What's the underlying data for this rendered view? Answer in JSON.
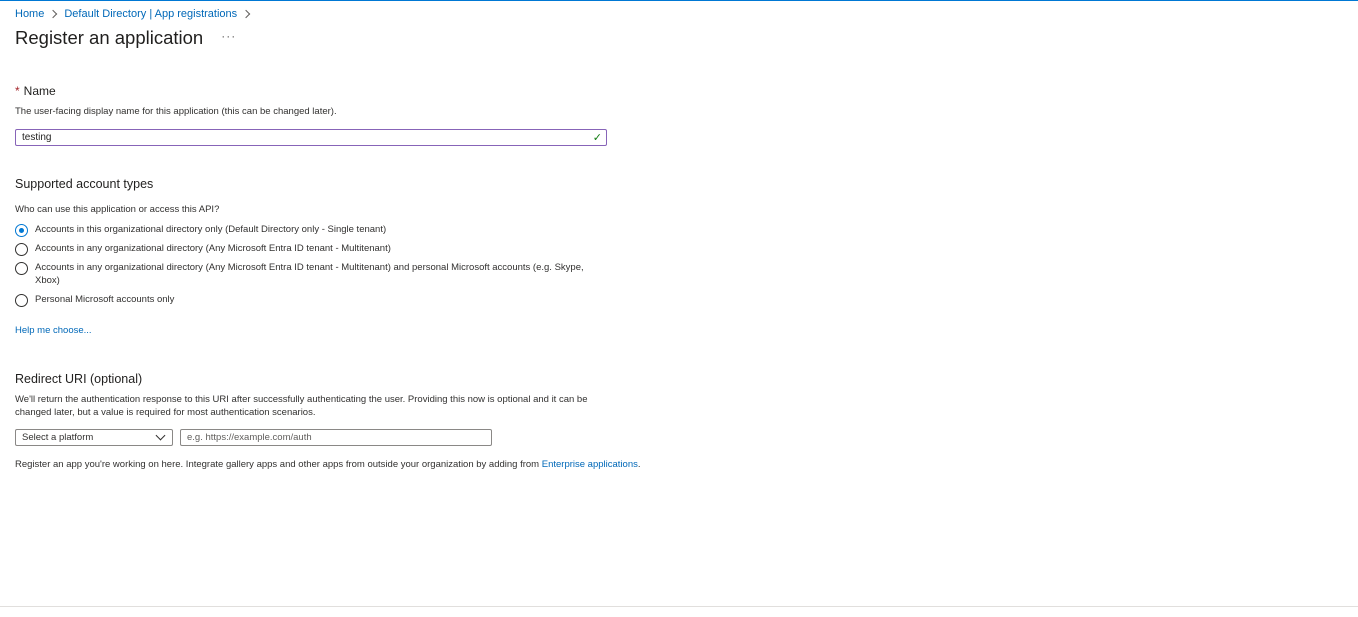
{
  "breadcrumb": {
    "items": [
      "Home",
      "Default Directory | App registrations"
    ]
  },
  "header": {
    "title": "Register an application",
    "more_label": "···"
  },
  "name_section": {
    "required_marker": "*",
    "label": "Name",
    "description": "The user-facing display name for this application (this can be changed later).",
    "value": "testing",
    "valid_icon": "checkmark-icon"
  },
  "account_types": {
    "heading": "Supported account types",
    "question": "Who can use this application or access this API?",
    "options": [
      {
        "label": "Accounts in this organizational directory only (Default Directory only - Single tenant)",
        "selected": true
      },
      {
        "label": "Accounts in any organizational directory (Any Microsoft Entra ID tenant - Multitenant)",
        "selected": false
      },
      {
        "label": "Accounts in any organizational directory (Any Microsoft Entra ID tenant - Multitenant) and personal Microsoft accounts (e.g. Skype, Xbox)",
        "selected": false
      },
      {
        "label": "Personal Microsoft accounts only",
        "selected": false
      }
    ],
    "help_link": "Help me choose..."
  },
  "redirect": {
    "heading": "Redirect URI (optional)",
    "description": "We'll return the authentication response to this URI after successfully authenticating the user. Providing this now is optional and it can be changed later, but a value is required for most authentication scenarios.",
    "platform_value": "Select a platform",
    "uri_placeholder": "e.g. https://example.com/auth"
  },
  "footer": {
    "note_text": "Register an app you're working on here. Integrate gallery apps and other apps from outside your organization by adding from ",
    "link_text": "Enterprise applications",
    "note_end": "."
  },
  "colors": {
    "accent": "#0078d4",
    "link": "#0068b8",
    "input_focus_border": "#8764b8",
    "required": "#a4262c"
  }
}
